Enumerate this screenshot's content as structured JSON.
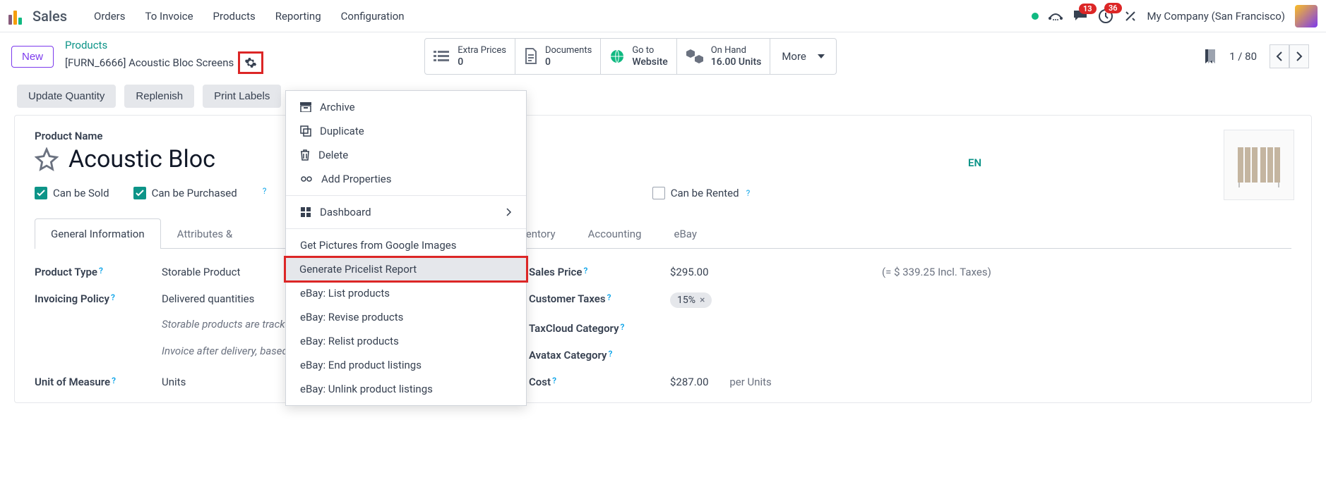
{
  "app": {
    "name": "Sales"
  },
  "nav": {
    "items": [
      "Orders",
      "To Invoice",
      "Products",
      "Reporting",
      "Configuration"
    ]
  },
  "topright": {
    "msg_badge": "13",
    "activity_badge": "36",
    "company": "My Company (San Francisco)"
  },
  "breadcrumb": {
    "new_btn": "New",
    "parent": "Products",
    "current": "[FURN_6666] Acoustic Bloc Screens"
  },
  "statboxes": {
    "extra_prices": {
      "label": "Extra Prices",
      "value": "0"
    },
    "documents": {
      "label": "Documents",
      "value": "0"
    },
    "website": {
      "label": "Go to",
      "value": "Website"
    },
    "onhand": {
      "label": "On Hand",
      "value": "16.00 Units"
    },
    "more": "More"
  },
  "pager": {
    "text": "1 / 80"
  },
  "dropdown": {
    "archive": "Archive",
    "duplicate": "Duplicate",
    "delete": "Delete",
    "add_props": "Add Properties",
    "dashboard": "Dashboard",
    "google": "Get Pictures from Google Images",
    "pricelist": "Generate Pricelist Report",
    "ebay_list": "eBay: List products",
    "ebay_revise": "eBay: Revise products",
    "ebay_relist": "eBay: Relist products",
    "ebay_end": "eBay: End product listings",
    "ebay_unlink": "eBay: Unlink product listings"
  },
  "toolbar": {
    "update_qty": "Update Quantity",
    "replenish": "Replenish",
    "print_labels": "Print Labels"
  },
  "product": {
    "name_label": "Product Name",
    "name": "Acoustic Bloc",
    "lang": "EN",
    "can_be_sold": "Can be Sold",
    "can_be_purchased": "Can be Purchased",
    "can_be_rented": "Can be Rented"
  },
  "tabs": {
    "general": "General Information",
    "attributes": "Attributes & ",
    "inventory": "Inventory",
    "accounting": "Accounting",
    "ebay": "eBay"
  },
  "fields": {
    "product_type_label": "Product Type",
    "product_type_value": "Storable Product",
    "invoicing_policy_label": "Invoicing Policy",
    "invoicing_policy_value": "Delivered quantities",
    "note1": "Storable products are tracked by inventory level.",
    "note2": "Invoice after delivery, based on quantities delivered, not ordered.",
    "uom_label": "Unit of Measure",
    "uom_value": "Units",
    "sales_price_label": "Sales Price",
    "sales_price_value": "$295.00",
    "sales_price_incl": "(= $ 339.25 Incl. Taxes)",
    "customer_taxes_label": "Customer Taxes",
    "customer_taxes_value": "15%",
    "taxcloud_label": "TaxCloud Category",
    "avatax_label": "Avatax Category",
    "cost_label": "Cost",
    "cost_value": "$287.00",
    "cost_unit": "per Units"
  }
}
